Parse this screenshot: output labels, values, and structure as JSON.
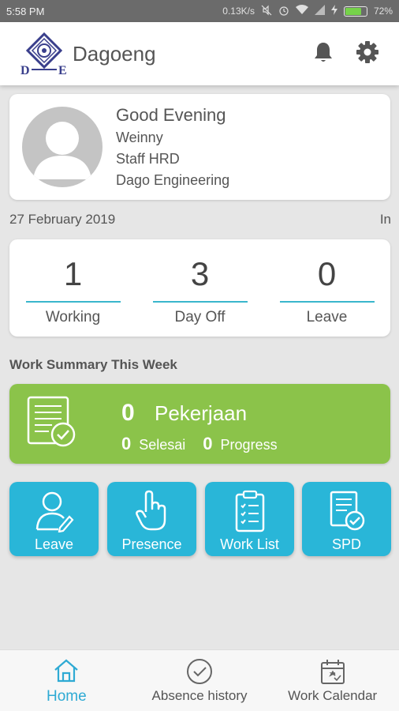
{
  "status_bar": {
    "time": "5:58 PM",
    "net_speed": "0.13K/s",
    "battery": "72%",
    "battery_level": 0.72,
    "icons": [
      "mute-icon",
      "alarm-icon",
      "wifi-icon",
      "signal-icon",
      "charging-icon",
      "battery-icon"
    ]
  },
  "app_bar": {
    "title": "Dagoeng",
    "logo_text": "D E",
    "icons": [
      "bell-icon",
      "gear-icon"
    ]
  },
  "profile": {
    "greeting": "Good Evening",
    "name": "Weinny",
    "position": "Staff HRD",
    "company": "Dago Engineering"
  },
  "date_row": {
    "date": "27 February 2019",
    "status": "In"
  },
  "stats": [
    {
      "value": "1",
      "label": "Working"
    },
    {
      "value": "3",
      "label": "Day Off"
    },
    {
      "value": "0",
      "label": "Leave"
    }
  ],
  "summary": {
    "title": "Work Summary This Week",
    "total_value": "0",
    "total_label": "Pekerjaan",
    "done_value": "0",
    "done_label": "Selesai",
    "progress_value": "0",
    "progress_label": "Progress"
  },
  "menu": [
    {
      "label": "Leave",
      "icon": "user-edit-icon"
    },
    {
      "label": "Presence",
      "icon": "hand-pointer-icon"
    },
    {
      "label": "Work List",
      "icon": "clipboard-list-icon"
    },
    {
      "label": "SPD",
      "icon": "document-check-icon"
    }
  ],
  "bottom_nav": [
    {
      "label": "Home",
      "icon": "home-icon",
      "active": true
    },
    {
      "label": "Absence history",
      "icon": "check-circle-icon",
      "active": false
    },
    {
      "label": "Work Calendar",
      "icon": "calendar-icon",
      "active": false
    }
  ],
  "colors": {
    "accent": "#29b6d8",
    "summary_green": "#8bc34a",
    "stat_line": "#39b6cc",
    "nav_active": "#2eaad4"
  }
}
